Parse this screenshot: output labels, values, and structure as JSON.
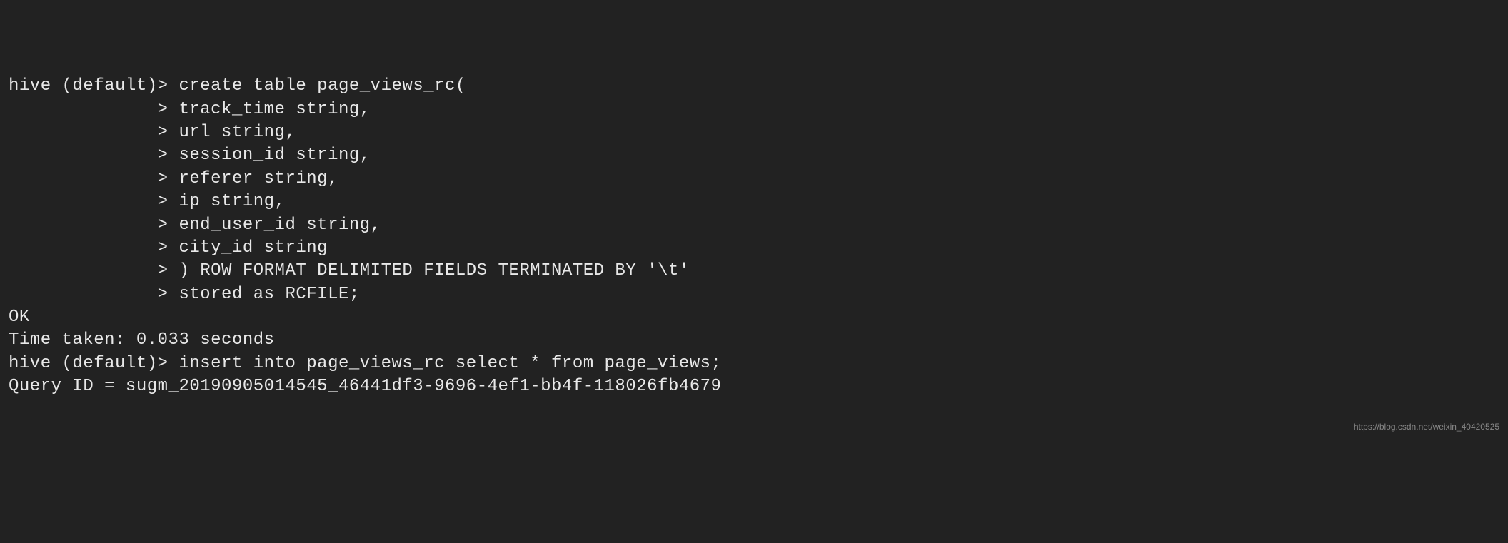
{
  "terminal": {
    "lines": [
      "hive (default)> create table page_views_rc(",
      "              > track_time string,",
      "              > url string,",
      "              > session_id string,",
      "              > referer string,",
      "              > ip string,",
      "              > end_user_id string,",
      "              > city_id string",
      "              > ) ROW FORMAT DELIMITED FIELDS TERMINATED BY '\\t'",
      "              > stored as RCFILE;",
      "OK",
      "Time taken: 0.033 seconds",
      "hive (default)> insert into page_views_rc select * from page_views;",
      "Query ID = sugm_20190905014545_46441df3-9696-4ef1-bb4f-118026fb4679"
    ]
  },
  "watermark": "https://blog.csdn.net/weixin_40420525"
}
